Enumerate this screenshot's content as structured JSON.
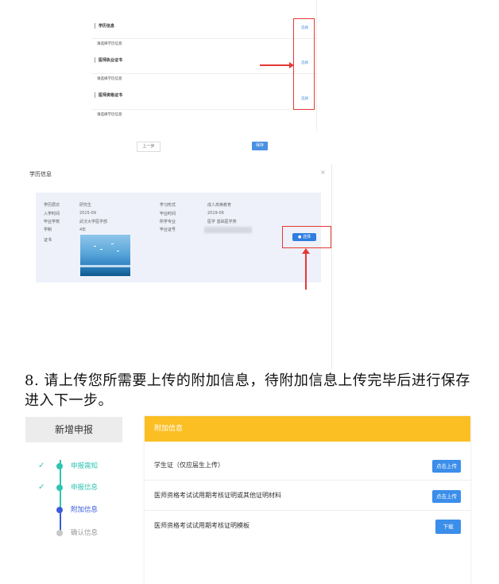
{
  "shot1": {
    "sections": [
      {
        "title": "学历信息",
        "note": "请选择学历信息",
        "link": "选择"
      },
      {
        "title": "医师执业证书",
        "note": "请选择学历信息",
        "link": "选择"
      },
      {
        "title": "医师资格证书",
        "note": "请选择学历信息",
        "link": "选择"
      }
    ],
    "prev_button": "上一步",
    "save_button": "保存"
  },
  "shot2": {
    "title": "学历信息",
    "close": "×",
    "fields": {
      "level_label": "学历层次",
      "level_value": "研究生",
      "study_form_label": "学习形式",
      "study_form_value": "成人高等教育",
      "enroll_label": "入学时间",
      "enroll_value": "2015-09",
      "grad_time_label": "毕业时间",
      "grad_time_value": "2019-06",
      "school_label": "毕业学校",
      "school_value": "武汉大学医学部",
      "major_label": "所学专业",
      "major_value": "医学 基础医学类",
      "duration_label": "学制",
      "duration_value": "4年",
      "cert_no_label": "毕业证号",
      "cert_label": "证书"
    },
    "select_button": "● 选择"
  },
  "instruction": "8. 请上传您所需要上传的附加信息，待附加信息上传完毕后进行保存进入下一步。",
  "shot3": {
    "sidebar_title": "新增申报",
    "steps": [
      {
        "label": "申报需知",
        "check": "✓"
      },
      {
        "label": "申报信息",
        "check": "✓"
      },
      {
        "label": "附加信息",
        "check": ""
      },
      {
        "label": "确认信息",
        "check": ""
      }
    ],
    "header": "附加信息",
    "rows": [
      {
        "label": "学生证（仅应届生上传）",
        "button": "点击上传"
      },
      {
        "label": "医师资格考试试用期考核证明或其他证明材料",
        "button": "点击上传"
      },
      {
        "label": "医师资格考试试用期考核证明模板",
        "button": "下载"
      }
    ],
    "colors": {
      "accent": "#fbbf24",
      "teal": "#2fc4b2",
      "blue": "#3b8eea",
      "active": "#3b5bdb",
      "red": "#e53935"
    }
  }
}
